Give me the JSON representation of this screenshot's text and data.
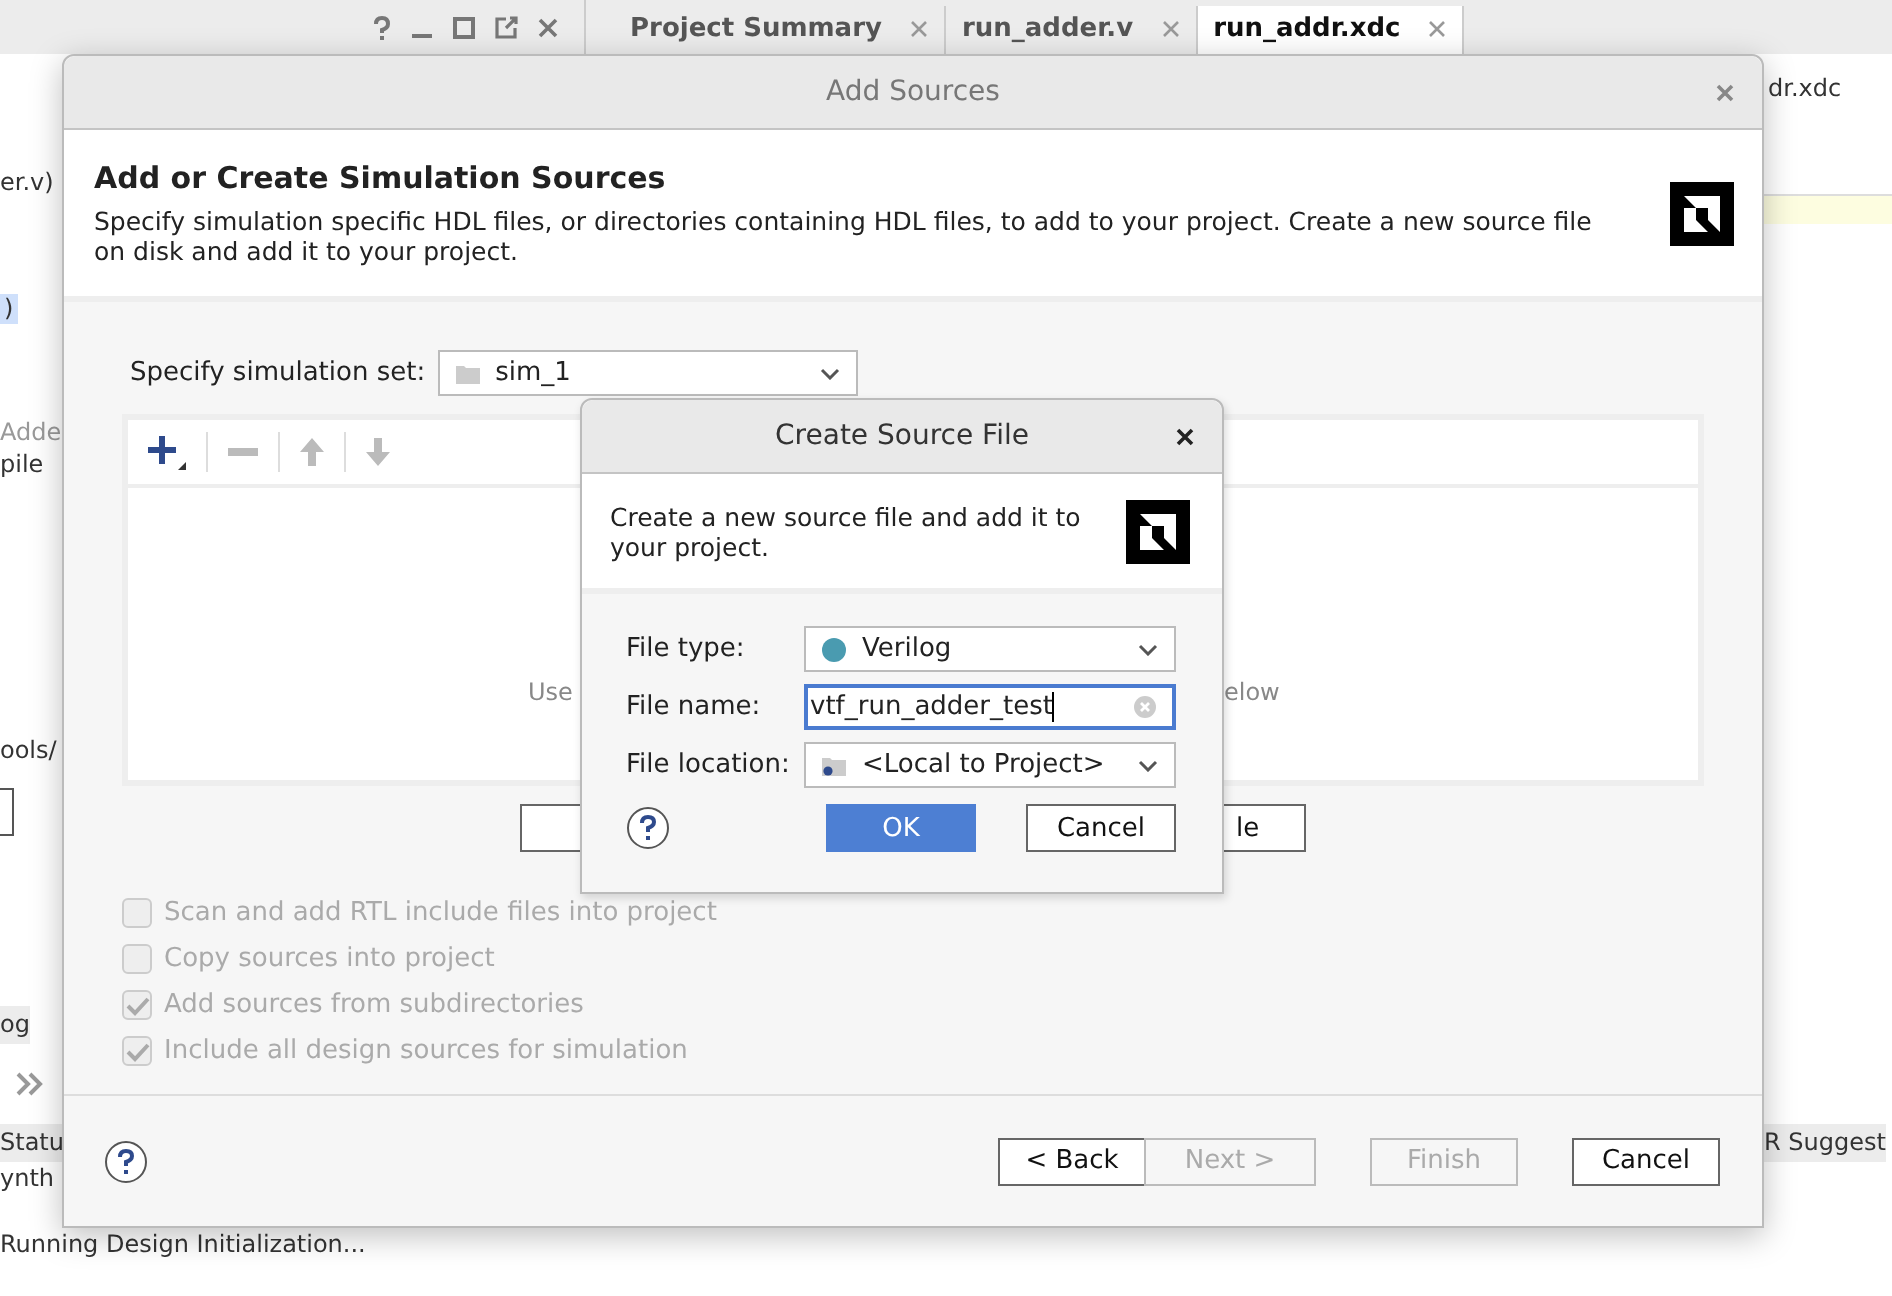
{
  "ide": {
    "tabs": [
      {
        "label": "Project Summary",
        "selected": false
      },
      {
        "label": "run_adder.v",
        "selected": false
      },
      {
        "label": "run_addr.xdc",
        "selected": true
      }
    ],
    "left_texts": [
      {
        "text": "er.v)",
        "kind": "plain"
      },
      {
        "text": ")",
        "kind": "highlight"
      },
      {
        "text": "Adde",
        "kind": "faint"
      },
      {
        "text": "pile",
        "kind": "plain"
      },
      {
        "text": "ools/",
        "kind": "plain"
      },
      {
        "text": "og",
        "kind": "header"
      },
      {
        "text": "Statu",
        "kind": "header"
      },
      {
        "text": "ynth",
        "kind": "plain"
      },
      {
        "text": "Running Design Initialization...",
        "kind": "plain"
      }
    ],
    "right_texts": [
      {
        "text": "dr.xdc",
        "kind": "plain"
      },
      {
        "text": "R Suggest",
        "kind": "header"
      }
    ]
  },
  "add_sources": {
    "title": "Add Sources",
    "heading": "Add or Create Simulation Sources",
    "description": "Specify simulation specific HDL files, or directories containing HDL files, to add to your project. Create a new source file on disk and add it to your project.",
    "sim_set_label": "Specify simulation set:",
    "sim_set_value": "sim_1",
    "table_hint_left": "Use",
    "table_hint_right": "elow",
    "right_button_label": "le",
    "options": [
      {
        "label": "Scan and add RTL include files into project",
        "checked": false,
        "disabled": true
      },
      {
        "label": "Copy sources into project",
        "checked": false,
        "disabled": true
      },
      {
        "label": "Add sources from subdirectories",
        "checked": true,
        "disabled": true
      },
      {
        "label": "Include all design sources for simulation",
        "checked": true,
        "disabled": true
      }
    ],
    "buttons": [
      {
        "label": "< Back",
        "disabled": false
      },
      {
        "label": "Next >",
        "disabled": true
      },
      {
        "label": "Finish",
        "disabled": true
      },
      {
        "label": "Cancel",
        "disabled": false
      }
    ]
  },
  "create_source": {
    "title": "Create Source File",
    "description": "Create a new source file and add it to your project.",
    "fields": [
      {
        "label": "File type:",
        "kind": "dropdown",
        "value": "Verilog",
        "color": "#4a9bb0"
      },
      {
        "label": "File name:",
        "kind": "input",
        "value": "vtf_run_adder_test"
      },
      {
        "label": "File location:",
        "kind": "location",
        "value": "<Local to Project>"
      }
    ],
    "buttons": [
      {
        "label": "OK",
        "primary": true
      },
      {
        "label": "Cancel",
        "primary": false
      }
    ]
  }
}
